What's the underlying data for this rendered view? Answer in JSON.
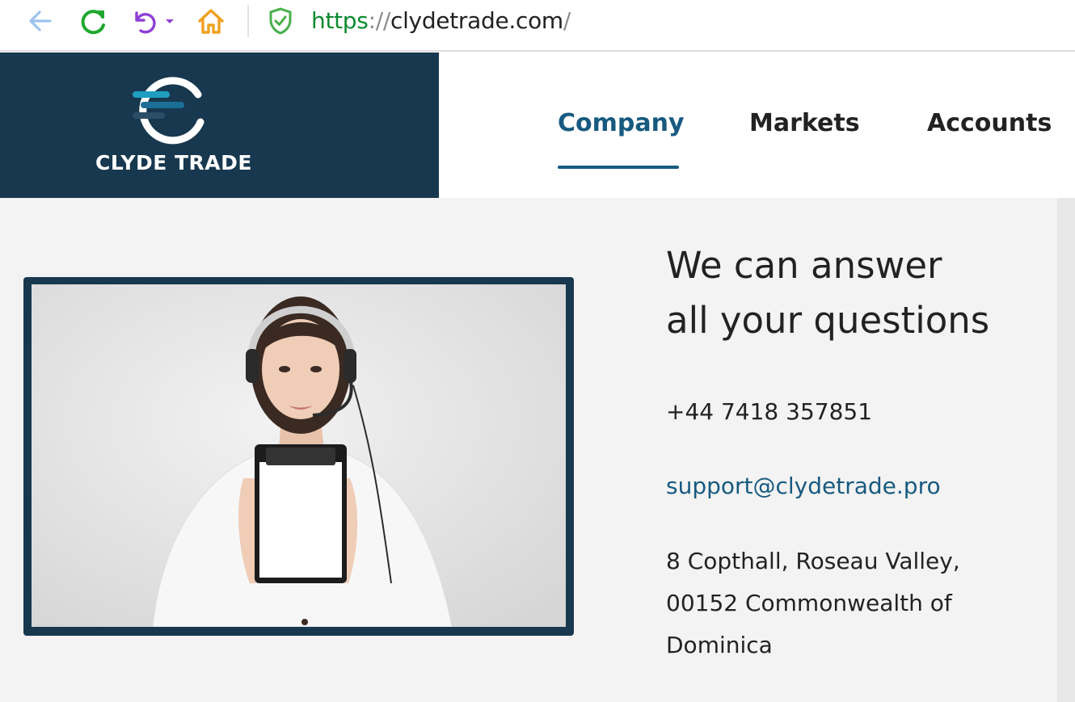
{
  "browser": {
    "url_scheme": "https",
    "url_sep": "://",
    "url_host": "clydetrade.com",
    "url_trailing": "/"
  },
  "site": {
    "brand": "CLYDE TRADE",
    "brand_color": "#17384f",
    "accent_color": "#175a80",
    "nav": [
      {
        "label": "Company",
        "active": true
      },
      {
        "label": "Markets",
        "active": false
      },
      {
        "label": "Accounts",
        "active": false
      }
    ]
  },
  "contact": {
    "heading_line1": "We can answer",
    "heading_line2": "all your questions",
    "phone": "+44 7418 357851",
    "email": "support@clydetrade.pro",
    "address_line1": "8 Copthall, Roseau Valley,",
    "address_line2": "00152 Commonwealth of",
    "address_line3": "Dominica"
  },
  "icons": [
    "back-arrow-icon",
    "reload-icon",
    "undo-icon",
    "dropdown-caret-icon",
    "home-icon",
    "shield-icon",
    "clyde-trade-logo-icon"
  ]
}
